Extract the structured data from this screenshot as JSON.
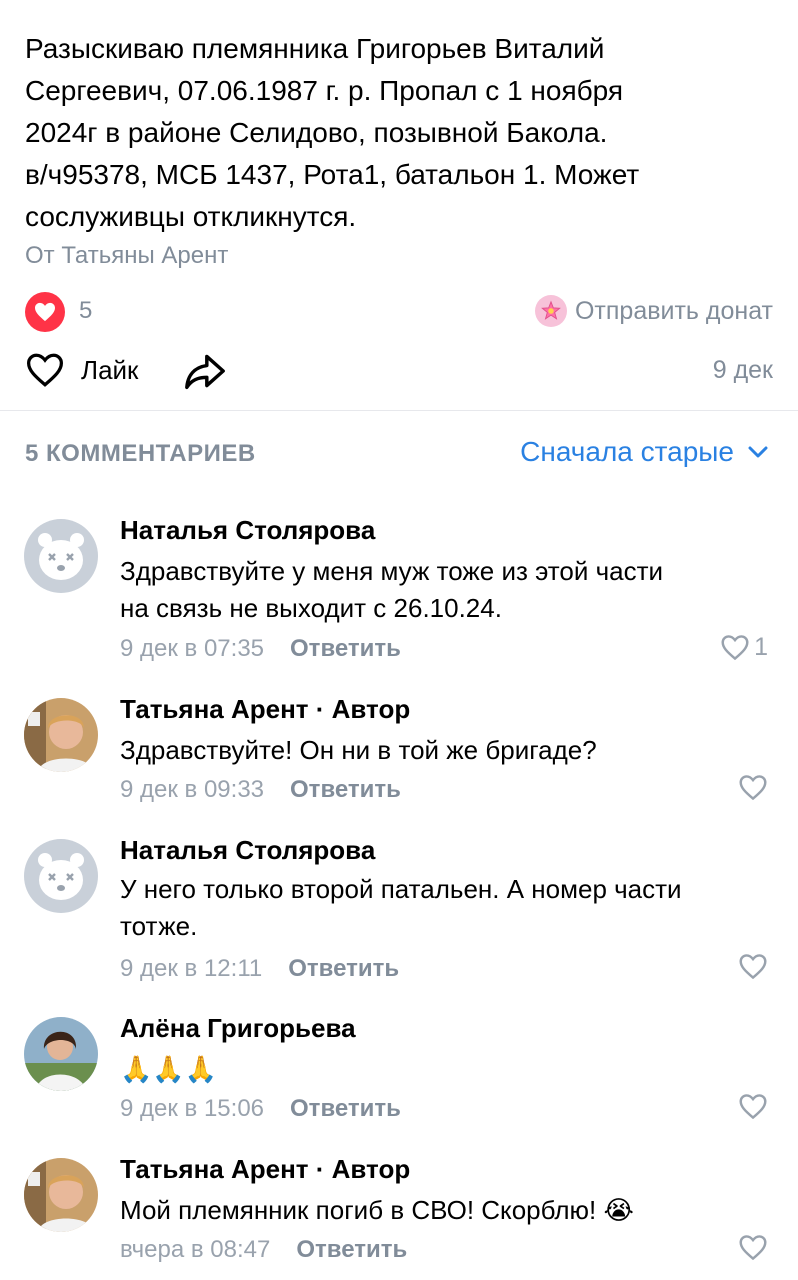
{
  "post": {
    "text": "Разыскиваю племянника  Григорьев Виталий\nСергеевич, 07.06.1987 г. р. Пропал с 1 ноября\n2024г в районе Селидово, позывной Бакола.\nв/ч95378, МСБ 1437, Рота1, батальон  1. Может\nсослуживцы откликнутся.",
    "author_line": "От Татьяны Арент",
    "likes_count": "5",
    "donate_label": "Отправить донат",
    "like_label": "Лайк",
    "date": "9 дек"
  },
  "comments_section": {
    "count_label": "5 КОММЕНТАРИЕВ",
    "sort_label": "Сначала старые"
  },
  "comments": [
    {
      "name": "Наталья Столярова",
      "text": "Здравствуйте у меня муж тоже из этой части\nна связь не выходит с 26.10.24.",
      "time": "9 дек в 07:35",
      "reply": "Ответить",
      "likes": "1",
      "avatar": "deleted-avatar-icon"
    },
    {
      "name": "Татьяна Арент · Автор",
      "text": "Здравствуйте! Он ни в той же бригаде?",
      "time": "9 дек в 09:33",
      "reply": "Ответить",
      "likes": "",
      "avatar": "photo"
    },
    {
      "name": "Наталья Столярова",
      "text": "У него только второй патальен. А номер части\nтотже.",
      "time": "9 дек в 12:11",
      "reply": "Ответить",
      "likes": "",
      "avatar": "deleted-avatar-icon"
    },
    {
      "name": "Алёна Григорьева",
      "text": "🙏🙏🙏",
      "time": "9 дек в 15:06",
      "reply": "Ответить",
      "likes": "",
      "avatar": "photo"
    },
    {
      "name": "Татьяна Арент · Автор",
      "text": "Мой племянник погиб в СВО! Скорблю! 😭",
      "time": "вчера в 08:47",
      "reply": "Ответить",
      "likes": "",
      "avatar": "photo"
    }
  ],
  "colors": {
    "accent": "#2a81e2",
    "like_red": "#ff3347",
    "secondary_text": "#818c99"
  }
}
